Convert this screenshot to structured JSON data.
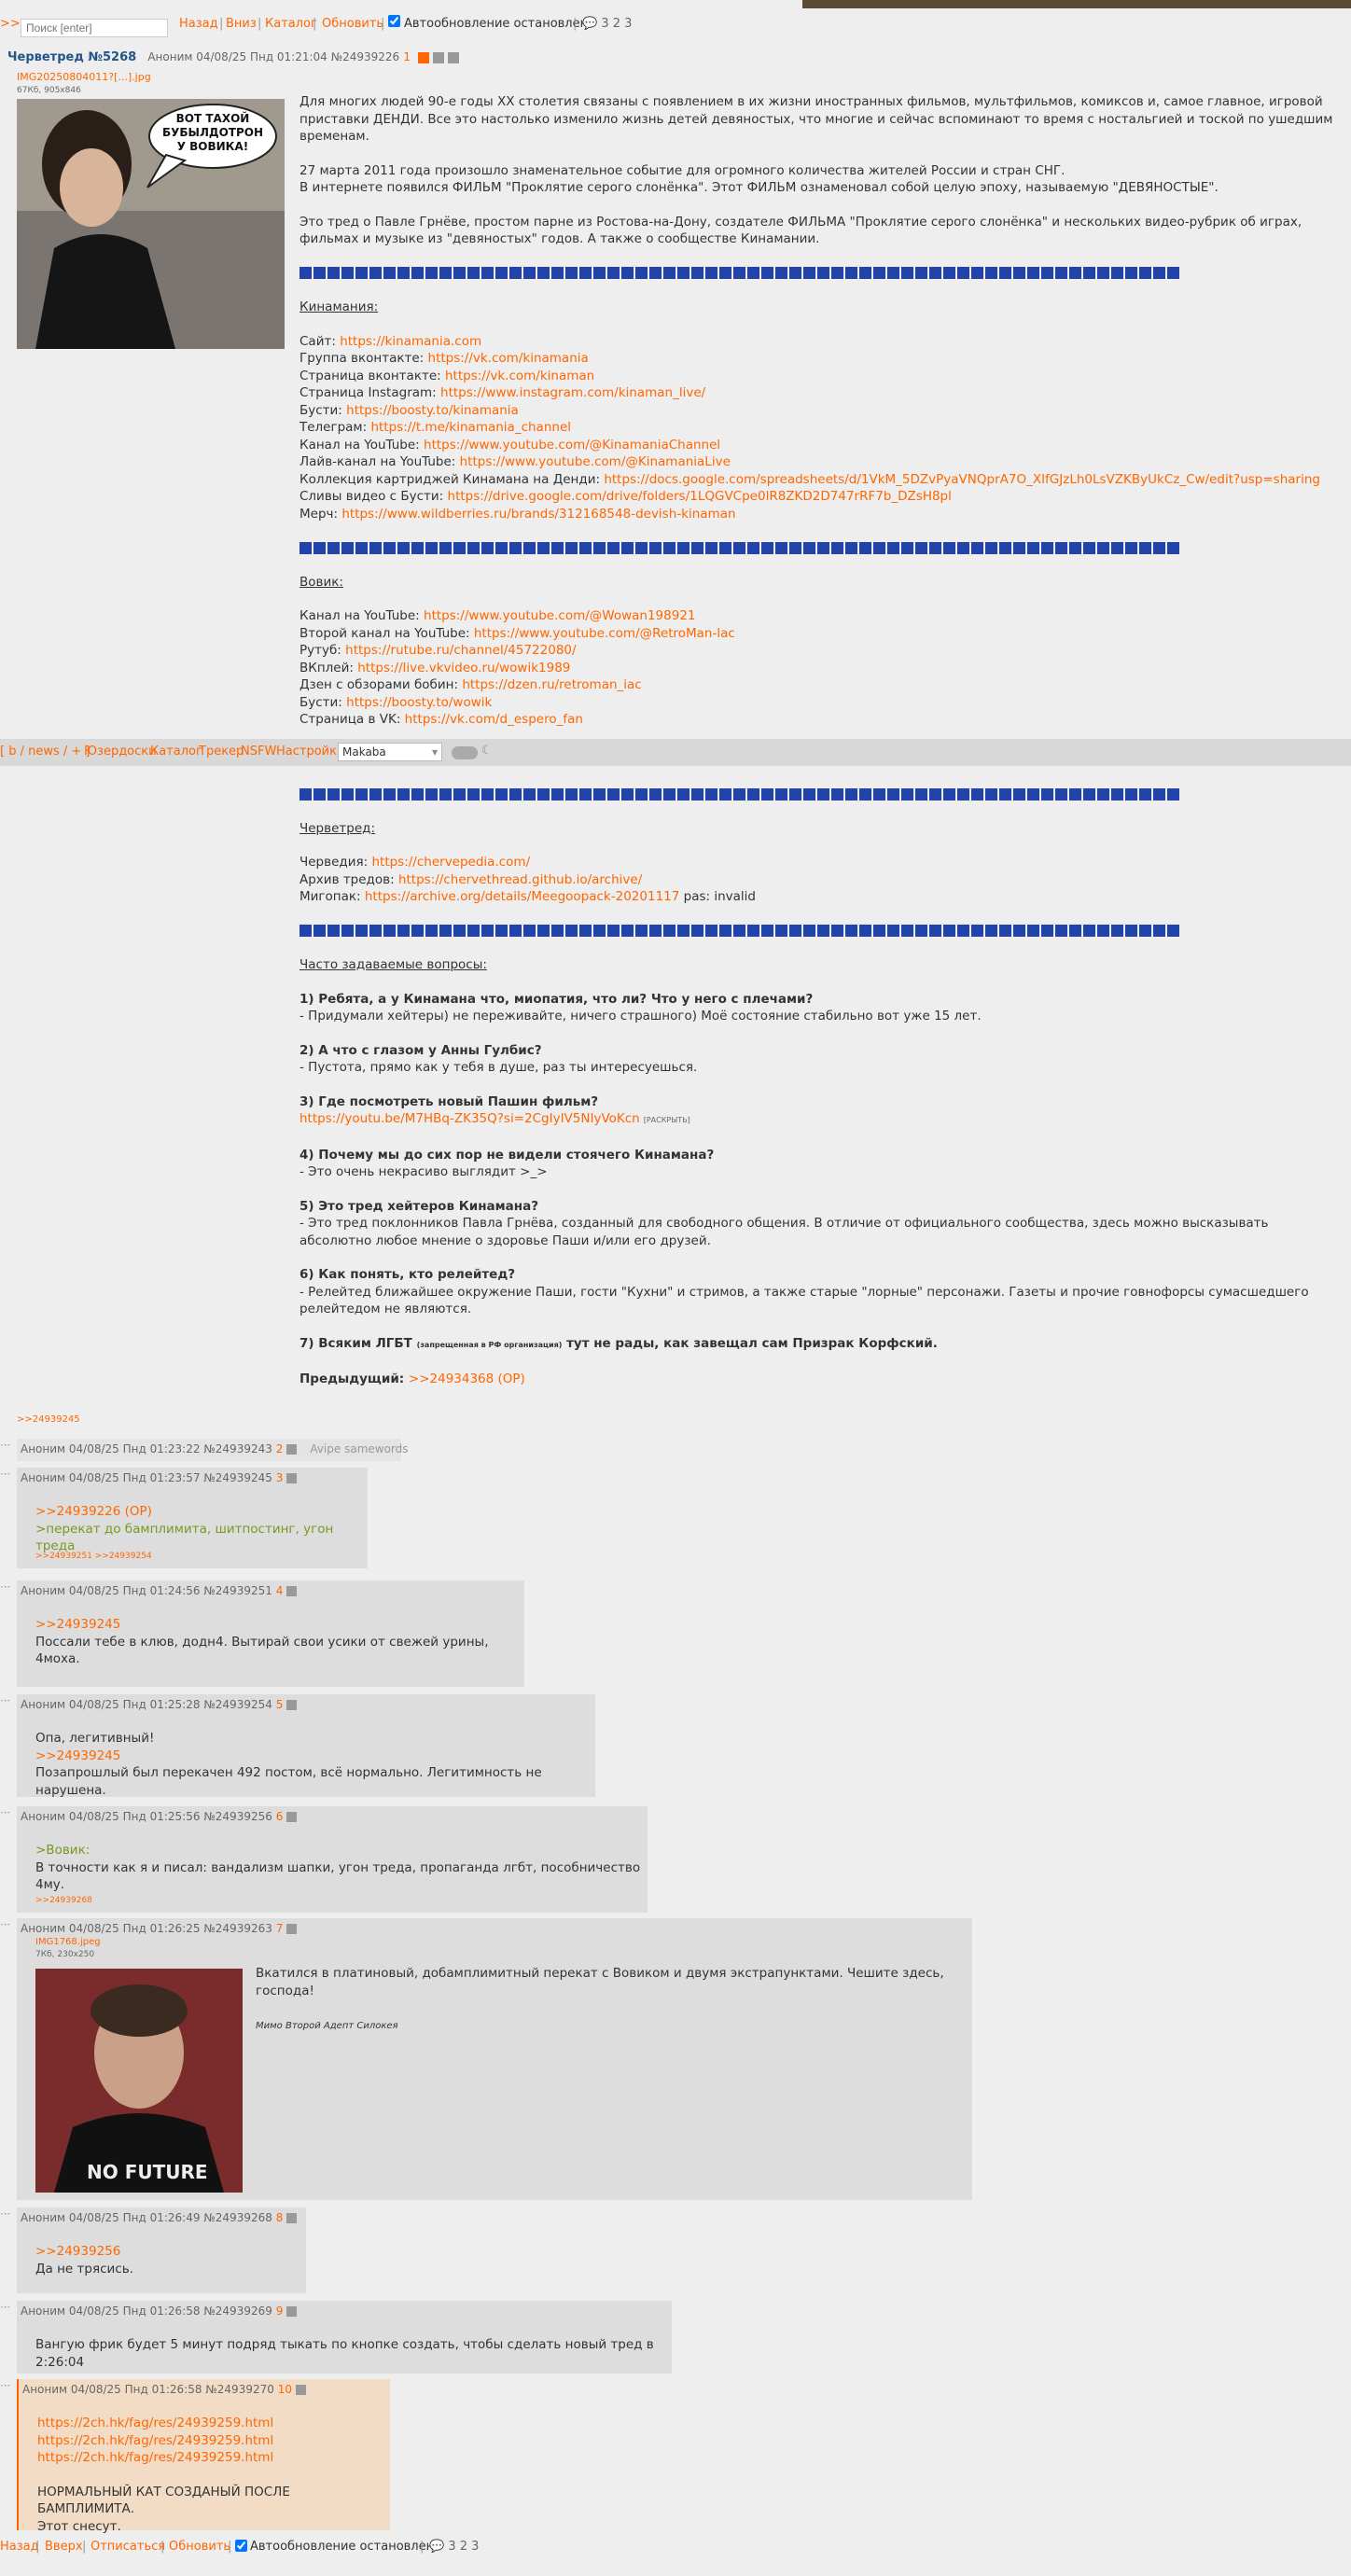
{
  "top": {
    "arrow": ">>",
    "search_placeholder": "Поиск [enter]",
    "links": [
      "Назад",
      "Вниз",
      "Каталог",
      "Обновить"
    ],
    "autoupdate": "Автообновление остановлено",
    "counts": "3  2  3"
  },
  "op": {
    "title": "Черветред №5268",
    "meta": "Аноним 04/08/25 Пнд 01:21:04 №24939226",
    "num": "1",
    "file": "IMG20250804011?[...].jpg",
    "fileinfo": "67Кб, 905x846",
    "speech": "ВОТ ТАХОЙ БУБЫЛДОТРОН У ВОВИКА!",
    "intro1": "Для многих людей 90-е годы XX столетия связаны с появлением в их жизни иностранных фильмов, мультфильмов, комиксов и, самое главное, игровой приставки ДЕНДИ. Все это настолько изменило жизнь детей девяностых, что многие и сейчас вспоминают то время с ностальгией и тоской по ушедшим временам.",
    "intro2": "27 марта 2011 года произошло знаменательное событие для огромного количества жителей России и стран СНГ.",
    "intro3": "В интернете появился ФИЛЬМ \"Проклятие серого слонёнка\". Этот ФИЛЬМ ознаменовал собой целую эпоху, называемую \"ДЕВЯНОСТЫЕ\".",
    "intro4": "Это тред о Павле Грнёве, простом парне из Ростова-на-Дону, создателе ФИЛЬМА \"Проклятие серого слонёнка\" и нескольких видео-рубрик об играх, фильмах и музыке из \"девяностых\" годов. А также о сообществе Кинамании.",
    "kin_header": "Кинамания:",
    "kin_links": [
      [
        "Сайт:",
        "https://kinamania.com"
      ],
      [
        "Группа вконтакте:",
        "https://vk.com/kinamania"
      ],
      [
        "Страница вконтакте:",
        "https://vk.com/kinaman"
      ],
      [
        "Страница Instagram:",
        "https://www.instagram.com/kinaman_live/"
      ],
      [
        "Бусти:",
        "https://boosty.to/kinamania"
      ],
      [
        "Телеграм:",
        "https://t.me/kinamania_channel"
      ],
      [
        "Канал на YouTube:",
        "https://www.youtube.com/@KinamaniaChannel"
      ],
      [
        "Лайв-канал на YouTube:",
        "https://www.youtube.com/@KinamaniaLive"
      ],
      [
        "Коллекция картриджей Кинамана на Денди:",
        "https://docs.google.com/spreadsheets/d/1VkM_5DZvPyaVNQprA7O_XIfGJzLh0LsVZKByUkCz_Cw/edit?usp=sharing"
      ],
      [
        "Сливы видео с Бусти:",
        "https://drive.google.com/drive/folders/1LQGVCpe0lR8ZKD2D747rRF7b_DZsH8pl"
      ],
      [
        "Мерч:",
        "https://www.wildberries.ru/brands/312168548-devish-kinaman"
      ]
    ],
    "vov_header": "Вовик:",
    "vov_links": [
      [
        "Канал на YouTube:",
        "https://www.youtube.com/@Wowan198921"
      ],
      [
        "Второй канал на YouTube:",
        "https://www.youtube.com/@RetroMan-lac"
      ],
      [
        "Рутуб:",
        "https://rutube.ru/channel/45722080/"
      ],
      [
        "ВКплей:",
        "https://live.vkvideo.ru/wowik1989"
      ],
      [
        "Дзен с обзорами бобин:",
        "https://dzen.ru/retroman_iac"
      ],
      [
        "Бусти:",
        "https://boosty.to/wowik"
      ],
      [
        "Страница в VK:",
        "https://vk.com/d_espero_fan"
      ]
    ],
    "cher_header": "Черветред:",
    "cher_links": [
      [
        "Черведия:",
        "https://chervepedia.com/"
      ],
      [
        "Архив тредов:",
        "https://chervethread.github.io/archive/"
      ],
      [
        "Мигопак:",
        "https://archive.org/details/Meegoopack-20201117"
      ]
    ],
    "pas": "pas: invalid",
    "faq_header": "Часто задаваемые вопросы:",
    "faq": [
      [
        "1) Ребята, а у Кинамана что, миопатия, что ли? Что у него с плечами?",
        "- Придумали хейтеры) не переживайте, ничего страшного) Моё состояние стабильно вот уже 15 лет."
      ],
      [
        "2) А что с глазом у Анны Гулбис?",
        "- Пустота, прямо как у тебя в душе, раз ты интересуешься."
      ],
      [
        "3) Где посмотреть новый Пашин фильм?",
        "https://youtu.be/M7HBq-ZK35Q?si=2CgIyIV5NIyVoKcn"
      ],
      [
        "4) Почему мы до сих пор не видели стоячего Кинамана?",
        "- Это очень некрасиво выглядит >_>"
      ],
      [
        "5) Это тред хейтеров Кинамана?",
        "- Это тред поклонников Павла Грнёва, созданный для свободного общения. В отличие от официального сообщества, здесь можно высказывать абсолютно любое мнение о здоровье Паши и/или его друзей."
      ],
      [
        "6) Как понять, кто релейтед?",
        "- Релейтед ближайшее окружение Паши, гости \"Кухни\" и стримов, а также старые \"лорные\" персонажи. Газеты и прочие говнофорсы сумасшедшего релейтедом не являются."
      ]
    ],
    "expand": "[РАСКРЫТЬ]",
    "faq7a": "7) Всяким ЛГБТ",
    "faq7small": "(запрещенная в РФ организация)",
    "faq7b": "тут не рады, как завещал сам Призрак Корфский.",
    "prev_label": "Предыдущий:",
    "prev_link": ">>24934368 (OP)",
    "reply_ref": ">>24939245"
  },
  "navbar": {
    "boards": "[ b / news / + ]",
    "links": [
      "Юзердоски",
      "Каталог",
      "Трекер",
      "NSFW",
      "Настройки"
    ],
    "style": "Makaba"
  },
  "posts": [
    {
      "meta": "Аноним 04/08/25 Пнд 01:23:22 №24939243",
      "num": "2",
      "extra": "Avipe samewords"
    },
    {
      "meta": "Аноним 04/08/25 Пнд 01:23:57 №24939245",
      "num": "3",
      "lines": [
        ">>24939226 (OP)",
        ">перекат до бамплимита, шитпостинг, угон треда"
      ],
      "replies": ">>24939251 >>24939254"
    },
    {
      "meta": "Аноним 04/08/25 Пнд 01:24:56 №24939251",
      "num": "4",
      "lines": [
        ">>24939245",
        "Поссали тебе в клюв, додн4. Вытирай свои усики от свежей урины, 4моха."
      ]
    },
    {
      "meta": "Аноним 04/08/25 Пнд 01:25:28 №24939254",
      "num": "5",
      "lines": [
        "Опа, легитивный!",
        ">>24939245",
        "Позапрошлый был перекачен 492 постом, всё нормально. Легитимность не нарушена."
      ]
    },
    {
      "meta": "Аноним 04/08/25 Пнд 01:25:56 №24939256",
      "num": "6",
      "lines": [
        ">Вовик:",
        "В точности как я и писал: вандализм шапки, угон треда, пропаганда лгбт, пособничество 4му."
      ],
      "replies": ">>24939268"
    },
    {
      "meta": "Аноним 04/08/25 Пнд 01:26:25 №24939263",
      "num": "7",
      "file": "IMG1768.jpeg",
      "fileinfo": "7Кб, 230x250",
      "shirt": "NO FUTURE",
      "lines": [
        "Вкатился в платиновый, добамплимитный перекат с Вовиком и двумя экстрапунктами. Чешите здесь, господа!"
      ],
      "sig": "Мимо Второй Адепт Силокея"
    },
    {
      "meta": "Аноним 04/08/25 Пнд 01:26:49 №24939268",
      "num": "8",
      "lines": [
        ">>24939256",
        "Да не трясись."
      ]
    },
    {
      "meta": "Аноним 04/08/25 Пнд 01:26:58 №24939269",
      "num": "9",
      "lines": [
        "Вангую фрик будет 5 минут подряд тыкать по кнопке создать, чтобы сделать новый тред в 2:26:04"
      ]
    },
    {
      "meta": "Аноним 04/08/25 Пнд 01:26:58 №24939270",
      "num": "10",
      "lines": [
        "https://2ch.hk/fag/res/24939259.html",
        "https://2ch.hk/fag/res/24939259.html",
        "https://2ch.hk/fag/res/24939259.html",
        "",
        "НОРМАЛЬНЫЙ КАТ СОЗДАНЫЙ ПОСЛЕ БАМПЛИМИТА.",
        "Этот снесут."
      ]
    }
  ],
  "bottom": {
    "links": [
      "Назад",
      "Вверх",
      "Отписаться",
      "Обновить"
    ],
    "autoupdate": "Автообновление остановлено",
    "counts": "3  2  3"
  }
}
